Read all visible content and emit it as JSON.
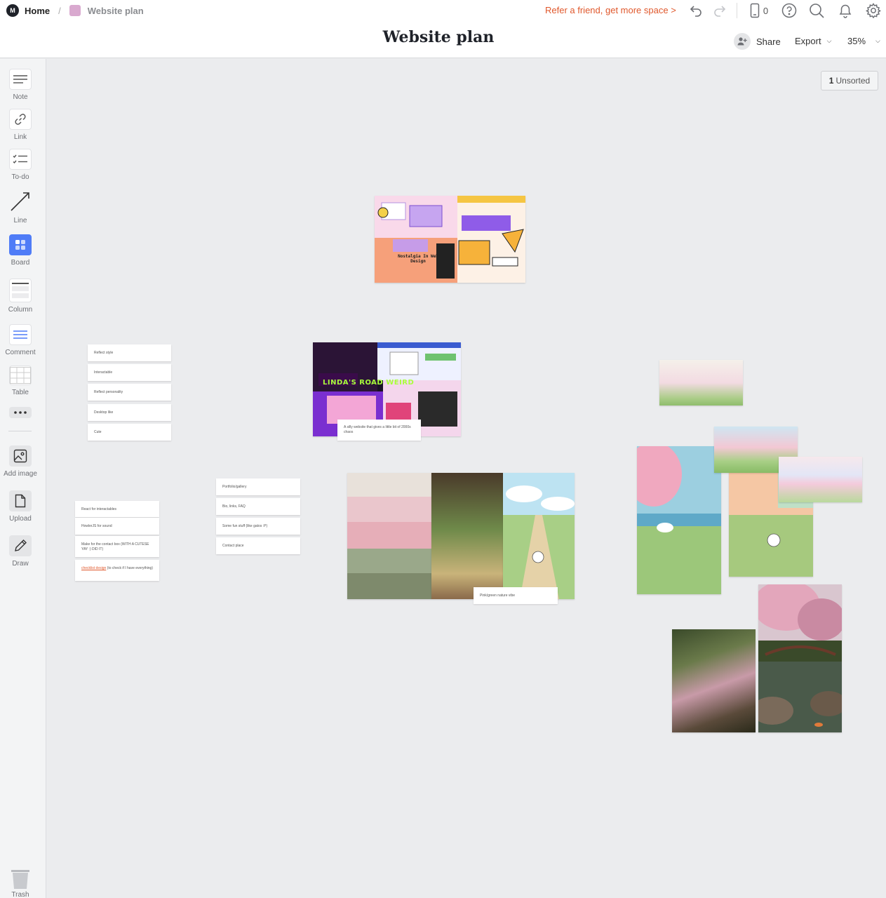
{
  "breadcrumb": {
    "home": "Home",
    "board": "Website plan"
  },
  "topbar": {
    "refer": "Refer a friend, get more space >",
    "device_count": "0",
    "title": "Website plan",
    "share": "Share",
    "export": "Export",
    "zoom": "35%"
  },
  "sidebar": {
    "tools": [
      "Note",
      "Link",
      "To-do",
      "Line",
      "Board",
      "Column",
      "Comment",
      "Table",
      "Add image",
      "Upload",
      "Draw"
    ],
    "trash": "Trash"
  },
  "unsorted": {
    "count": "1",
    "label": "Unsorted"
  },
  "column1": [
    "Reflect style",
    "Interactable",
    "Reflect personality",
    "Desktop like",
    "Cute"
  ],
  "column2": [
    "Portfolio/gallery",
    "Bio, links, FAQ",
    "Some fun stuff (like gatos :P)",
    "Contact place"
  ],
  "column3": {
    "items": [
      "React for interactables",
      "HowlerJS for sound",
      "Make for the contact box (WITH A CUTESE YAY :) DID IT)"
    ],
    "last_link": "checklist design",
    "last_rest": " (to check if I have everything)"
  },
  "captions": {
    "chaos": "A silly website that gives a little bit of 2000s chaos",
    "nature": "Pink/green nature vibe"
  },
  "moodboard": {
    "nostalgia": "Nostalgia In Web Design",
    "weird": "LINDA'S ROAD WEIRD"
  },
  "colors": {
    "accent": "#e0582c",
    "board_active": "#4f7cf7",
    "board_swatch": "#d9a9cf"
  }
}
